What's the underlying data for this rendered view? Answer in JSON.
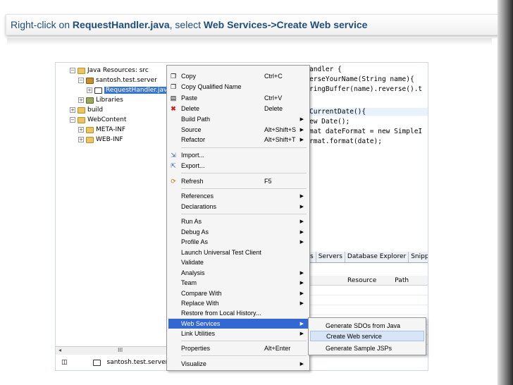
{
  "slide_title": {
    "prefix": "Right-click on ",
    "file": "RequestHandler.java",
    "middle": ", select ",
    "path": "Web Services->Create Web service"
  },
  "project_tree": [
    {
      "label": "Java Resources: src",
      "icon": "folder-icon"
    },
    {
      "label": "santosh.test.server",
      "icon": "package-icon"
    },
    {
      "label": "RequestHandler.java",
      "icon": "java-file-icon",
      "selected": true
    },
    {
      "label": "Libraries",
      "icon": "library-icon"
    },
    {
      "label": "build",
      "icon": "folder-icon"
    },
    {
      "label": "WebContent",
      "icon": "folder-icon"
    },
    {
      "label": "META-INF",
      "icon": "folder-icon"
    },
    {
      "label": "WEB-INF",
      "icon": "folder-icon"
    }
  ],
  "code_lines": [
    "andler {",
    "erseYourName(String name){",
    "ringBuffer(name).reverse().t",
    "CurrentDate(){",
    "ew Date();",
    "mat dateFormat = new SimpleI",
    "rmat.format(date);"
  ],
  "views_tabs": [
    "s",
    "Servers",
    "Database Explorer",
    "Snippets"
  ],
  "views_columns": [
    "Resource",
    "Path"
  ],
  "context_menu": [
    {
      "label": "Copy",
      "accel": "Ctrl+C",
      "icon": "copy-icon"
    },
    {
      "label": "Copy Qualified Name",
      "accel": "",
      "icon": "copy-icon"
    },
    {
      "label": "Paste",
      "accel": "Ctrl+V",
      "icon": "paste-icon"
    },
    {
      "label": "Delete",
      "accel": "Delete",
      "icon": "delete-icon"
    },
    {
      "label": "Build Path",
      "accel": "",
      "submenu": true
    },
    {
      "label": "Source",
      "accel": "Alt+Shift+S",
      "submenu": true
    },
    {
      "label": "Refactor",
      "accel": "Alt+Shift+T",
      "submenu": true
    },
    {
      "label": "Import...",
      "icon": "import-icon"
    },
    {
      "label": "Export...",
      "icon": "export-icon"
    },
    {
      "label": "Refresh",
      "accel": "F5",
      "icon": "refresh-icon"
    },
    {
      "label": "References",
      "submenu": true
    },
    {
      "label": "Declarations",
      "submenu": true
    },
    {
      "label": "Run As",
      "submenu": true
    },
    {
      "label": "Debug As",
      "submenu": true
    },
    {
      "label": "Profile As",
      "submenu": true
    },
    {
      "label": "Launch Universal Test Client"
    },
    {
      "label": "Validate"
    },
    {
      "label": "Analysis",
      "submenu": true
    },
    {
      "label": "Team",
      "submenu": true
    },
    {
      "label": "Compare With",
      "submenu": true
    },
    {
      "label": "Replace With",
      "submenu": true
    },
    {
      "label": "Restore from Local History..."
    },
    {
      "label": "Web Services",
      "submenu": true,
      "highlighted": true
    },
    {
      "label": "Link Utilities",
      "submenu": true
    },
    {
      "label": "Properties",
      "accel": "Alt+Enter"
    },
    {
      "label": "Visualize",
      "submenu": true
    }
  ],
  "web_services_submenu": [
    {
      "label": "Generate SDOs from Java"
    },
    {
      "label": "Create Web service",
      "highlighted": true
    },
    {
      "label": "Generate Sample JSPs"
    }
  ],
  "status": {
    "label": "santosh.test.server.Re"
  },
  "scroll_glyph": "III"
}
